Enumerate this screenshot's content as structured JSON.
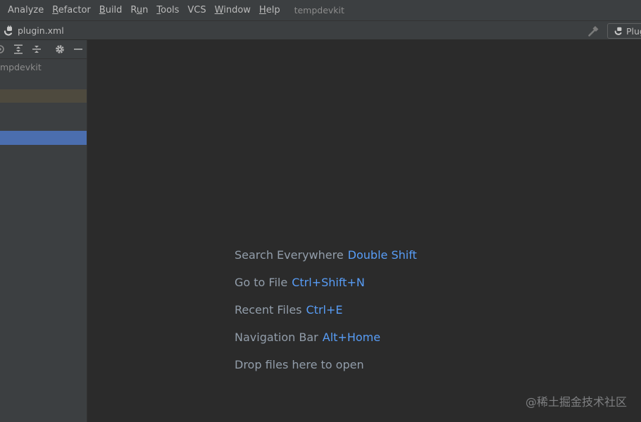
{
  "menubar": {
    "items": [
      {
        "label": "Analyze",
        "mnemonic_index": -1
      },
      {
        "label": "Refactor",
        "mnemonic_index": 0
      },
      {
        "label": "Build",
        "mnemonic_index": 0
      },
      {
        "label": "Run",
        "mnemonic_index": 1
      },
      {
        "label": "Tools",
        "mnemonic_index": 0
      },
      {
        "label": "VCS",
        "mnemonic_index": -1
      },
      {
        "label": "Window",
        "mnemonic_index": 0
      },
      {
        "label": "Help",
        "mnemonic_index": 0
      }
    ],
    "project_title": "tempdevkit"
  },
  "navbar": {
    "file_name": "plugin.xml",
    "file_icon": "plugin-icon",
    "build_icon": "hammer-icon",
    "run_config_label": "Plug"
  },
  "sidebar": {
    "toolbar_icons": [
      "locate-icon",
      "expand-all-icon",
      "collapse-all-icon",
      "gear-icon",
      "hide-icon"
    ],
    "tree_root_label": "tempdevkit",
    "tree_root_visible": "mpdevkit"
  },
  "editor": {
    "hints": [
      {
        "label": "Search Everywhere",
        "shortcut": "Double Shift"
      },
      {
        "label": "Go to File",
        "shortcut": "Ctrl+Shift+N"
      },
      {
        "label": "Recent Files",
        "shortcut": "Ctrl+E"
      },
      {
        "label": "Navigation Bar",
        "shortcut": "Alt+Home"
      },
      {
        "label": "Drop files here to open",
        "shortcut": ""
      }
    ]
  },
  "watermark": "@稀土掘金技术社区",
  "colors": {
    "chrome": "#3c3f41",
    "editor_bg": "#2b2b2b",
    "selection": "#4b6eaf",
    "shortcut": "#589df6",
    "text": "#bbbbbb"
  }
}
